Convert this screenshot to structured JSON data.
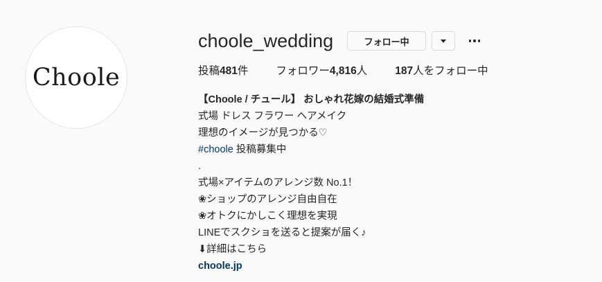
{
  "profile": {
    "avatar_logo": "Choole",
    "username": "choole_wedding",
    "follow_button": "フォロー中",
    "stats": {
      "posts_label": "投稿",
      "posts_count": "481",
      "posts_suffix": "件",
      "followers_label": "フォロワー",
      "followers_count": "4,816",
      "followers_suffix": "人",
      "following_count": "187",
      "following_suffix": "人をフォロー中"
    },
    "bio": {
      "name": "【Choole / チュール】 おしゃれ花嫁の結婚式準備",
      "line1": "式場 ドレス フラワー ヘアメイク",
      "line2": "理想のイメージが見つかる♡",
      "hashtag": "#choole",
      "hashtag_suffix": " 投稿募集中",
      "line4": ".",
      "line5": "式場×アイテムのアレンジ数 No.1！",
      "line6": "❀ショップのアレンジ自由自在",
      "line7": "❀オトクにかしこく理想を実現",
      "line8": "LINEでスクショを送ると提案が届く♪",
      "line9": "⬇詳細はこちら",
      "link": "choole.jp"
    }
  },
  "colors": {
    "background": "#fafafa",
    "text": "#262626",
    "link": "#00376b",
    "border": "#dbdbdb"
  },
  "icons": [
    "chevron-down-icon",
    "more-options-icon"
  ]
}
